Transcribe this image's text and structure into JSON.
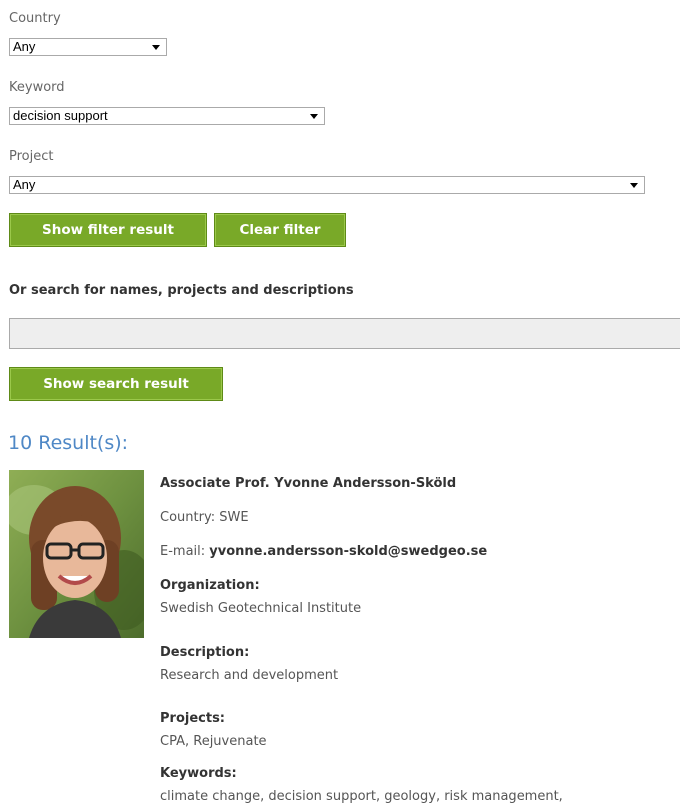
{
  "filters": {
    "country": {
      "label": "Country",
      "value": "Any"
    },
    "keyword": {
      "label": "Keyword",
      "value": "decision support"
    },
    "project": {
      "label": "Project",
      "value": "Any"
    },
    "show_filter_label": "Show filter result",
    "clear_filter_label": "Clear filter"
  },
  "search": {
    "heading": "Or search for names, projects and descriptions",
    "value": "",
    "button_label": "Show search result"
  },
  "results": {
    "count_text": "10 Result(s):",
    "items": [
      {
        "name": "Associate Prof. Yvonne Andersson-Sköld",
        "country_text": "Country: SWE",
        "email_prefix": "E-mail: ",
        "email": "yvonne.andersson-skold@swedgeo.se",
        "organization_label": "Organization:",
        "organization": "Swedish Geotechnical Institute",
        "description_label": "Description:",
        "description": "Research and development",
        "projects_label": "Projects:",
        "projects": "CPA, Rejuvenate",
        "keywords_label": "Keywords:",
        "keywords": "climate change, decision support, geology, risk management,"
      }
    ]
  },
  "colors": {
    "button_green": "#79a928",
    "results_blue": "#4f88c6"
  }
}
